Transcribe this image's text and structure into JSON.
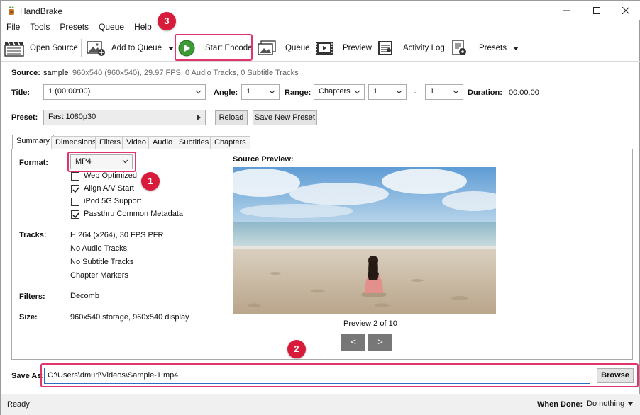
{
  "window": {
    "title": "HandBrake"
  },
  "menu": [
    "File",
    "Tools",
    "Presets",
    "Queue",
    "Help"
  ],
  "toolbar": {
    "open_source": "Open Source",
    "add_to_queue": "Add to Queue",
    "start_encode": "Start Encode",
    "queue": "Queue",
    "preview": "Preview",
    "activity_log": "Activity Log",
    "presets": "Presets"
  },
  "source": {
    "label": "Source:",
    "name": "sample",
    "info": "960x540 (960x540), 29.97 FPS, 0 Audio Tracks, 0 Subtitle Tracks"
  },
  "title_row": {
    "title_label": "Title:",
    "title_value": "1  (00:00:00)",
    "angle_label": "Angle:",
    "angle_value": "1",
    "range_label": "Range:",
    "range_mode": "Chapters",
    "range_start": "1",
    "range_dash": "-",
    "range_end": "1",
    "duration_label": "Duration:",
    "duration_value": "00:00:00"
  },
  "preset": {
    "label": "Preset:",
    "value": "Fast 1080p30",
    "reload": "Reload",
    "save_new": "Save New Preset"
  },
  "tabs": [
    "Summary",
    "Dimensions",
    "Filters",
    "Video",
    "Audio",
    "Subtitles",
    "Chapters"
  ],
  "summary": {
    "format_label": "Format:",
    "format_value": "MP4",
    "options": [
      {
        "label": "Web Optimized",
        "checked": false
      },
      {
        "label": "Align A/V Start",
        "checked": true
      },
      {
        "label": "iPod 5G Support",
        "checked": false
      },
      {
        "label": "Passthru Common Metadata",
        "checked": true
      }
    ],
    "tracks_label": "Tracks:",
    "tracks": [
      "H.264 (x264), 30 FPS PFR",
      "No Audio Tracks",
      "No Subtitle Tracks",
      "Chapter Markers"
    ],
    "filters_label": "Filters:",
    "filters_value": "Decomb",
    "size_label": "Size:",
    "size_value": "960x540 storage, 960x540 display",
    "source_preview_label": "Source Preview:",
    "preview_caption": "Preview 2 of 10",
    "prev": "<",
    "next": ">"
  },
  "save_as": {
    "label": "Save As:",
    "value": "C:\\Users\\dmuri\\Videos\\Sample-1.mp4",
    "browse": "Browse"
  },
  "status": {
    "text": "Ready",
    "when_done_label": "When Done:",
    "when_done_value": "Do nothing"
  },
  "callouts": [
    "1",
    "2",
    "3"
  ],
  "colors": {
    "callout": "#d81b3b",
    "highlight": "#e0356a",
    "focus": "#2a6fc4"
  }
}
